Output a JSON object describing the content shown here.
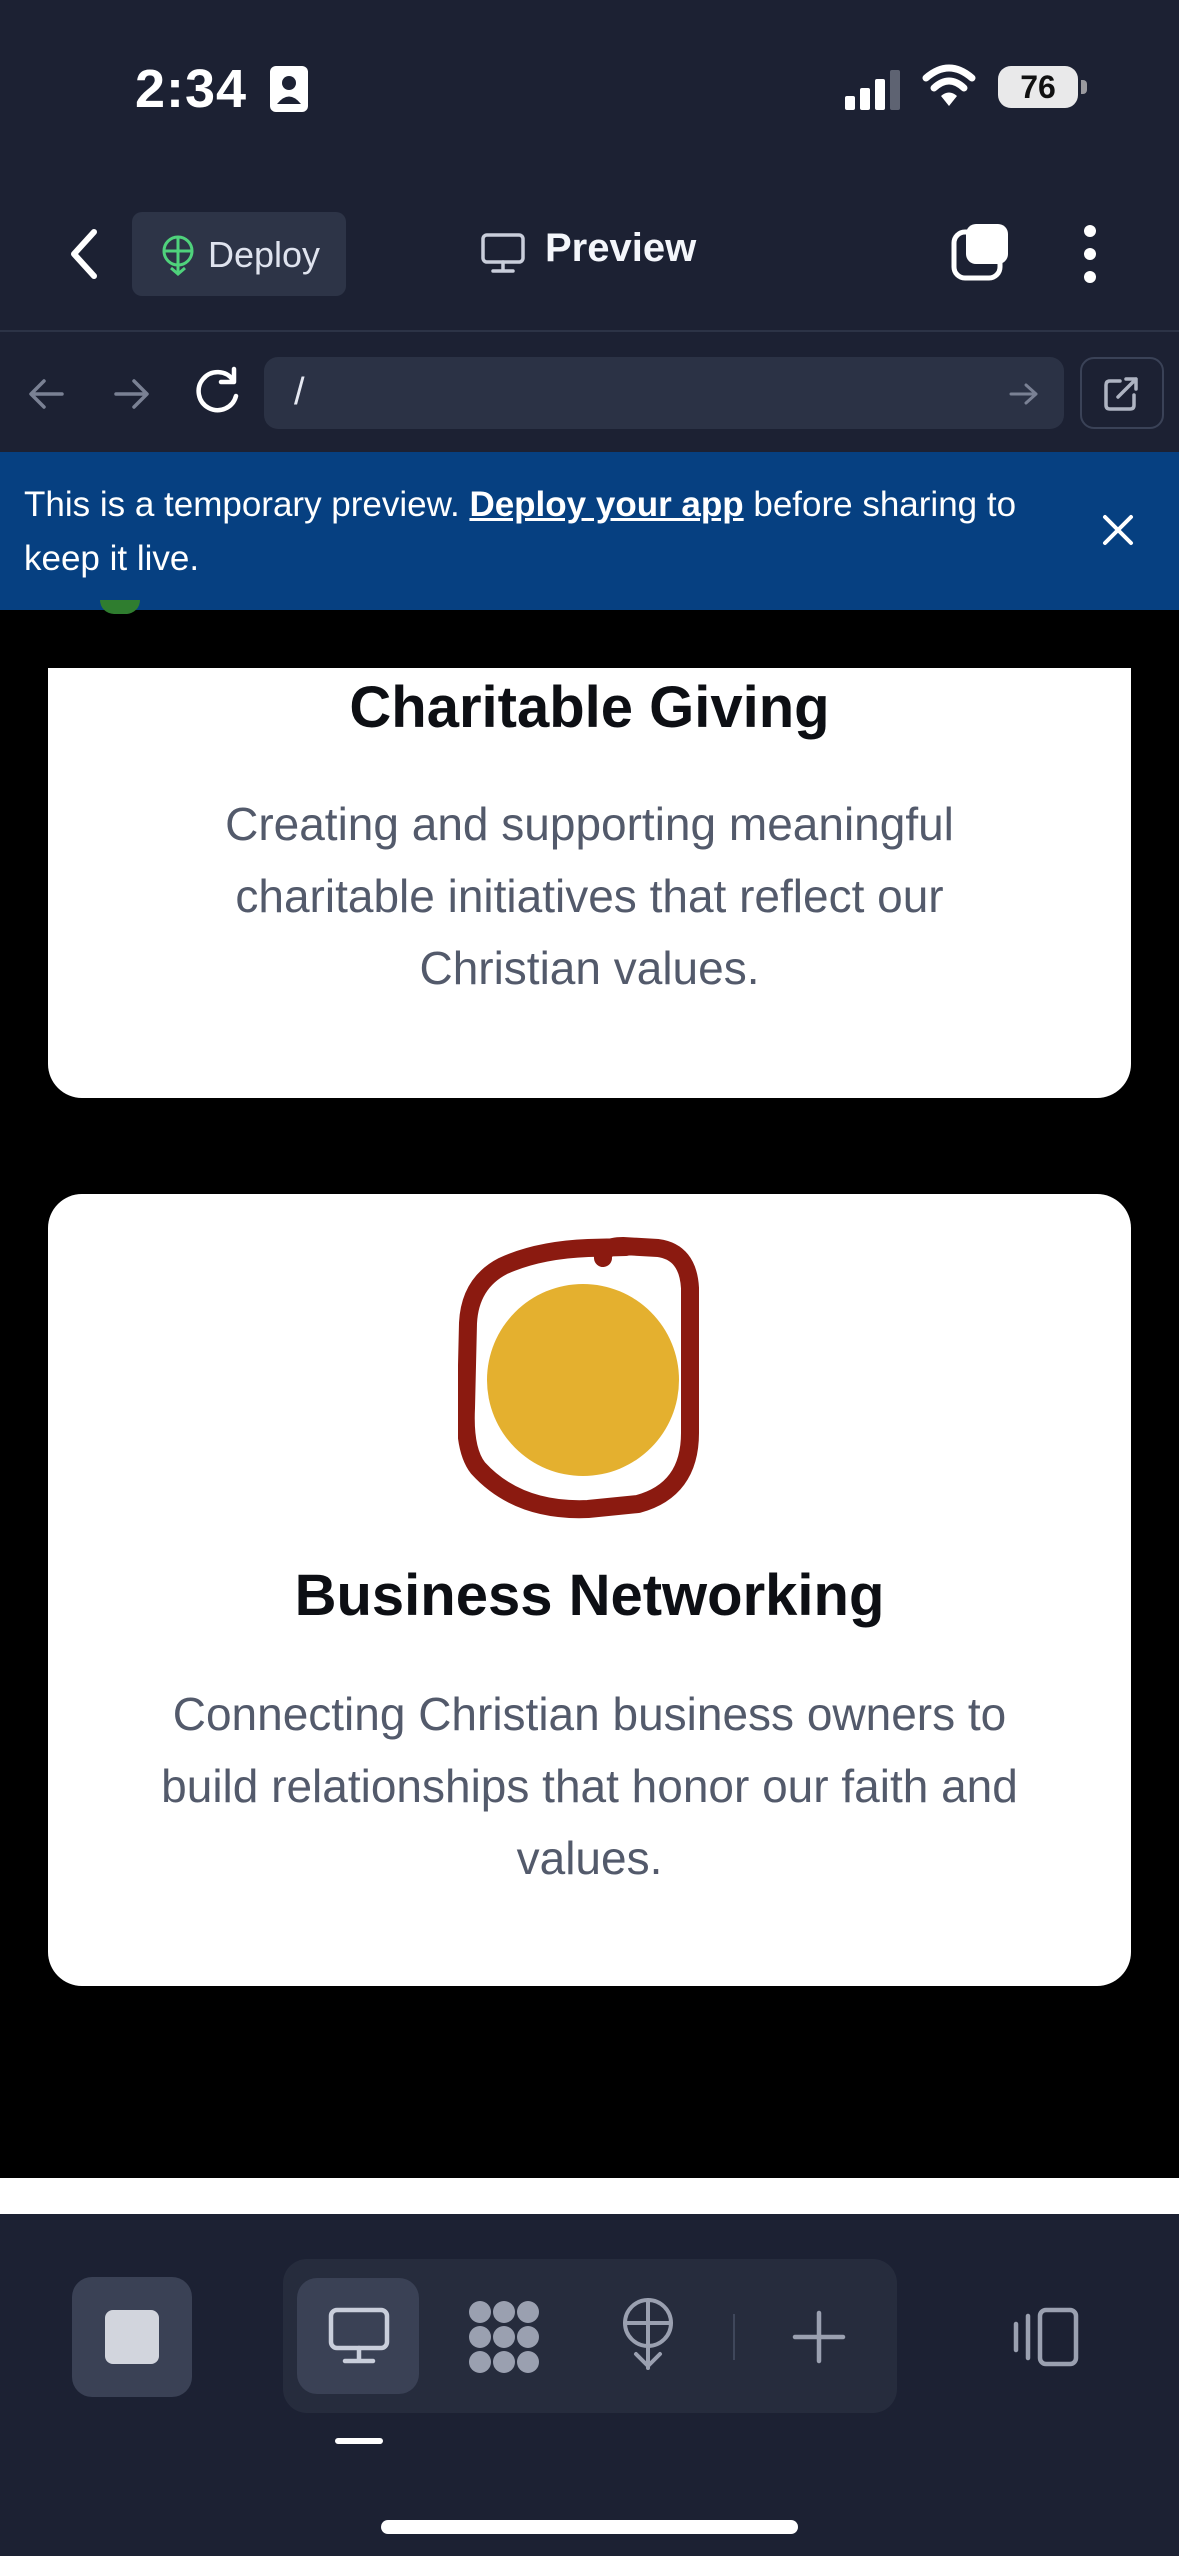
{
  "status_bar": {
    "time": "2:34",
    "battery": "76"
  },
  "header": {
    "deploy_label": "Deploy",
    "preview_label": "Preview"
  },
  "url_bar": {
    "path": "/"
  },
  "banner": {
    "text_before": "This is a temporary preview. ",
    "link_text": "Deploy your app",
    "text_after": " before sharing to keep it live."
  },
  "cards": [
    {
      "title": "Charitable Giving",
      "description": "Creating and supporting meaningful charitable initiatives that reflect our Christian values."
    },
    {
      "title": "Business Networking",
      "description": "Connecting Christian business owners to build relationships that honor our faith and values.",
      "icon": "sun-in-frame-icon",
      "icon_colors": {
        "frame": "#8b1a10",
        "circle": "#e4b02f"
      }
    }
  ],
  "colors": {
    "header_bg": "#1c2133",
    "banner_bg": "#064081",
    "page_bg": "#000000"
  }
}
